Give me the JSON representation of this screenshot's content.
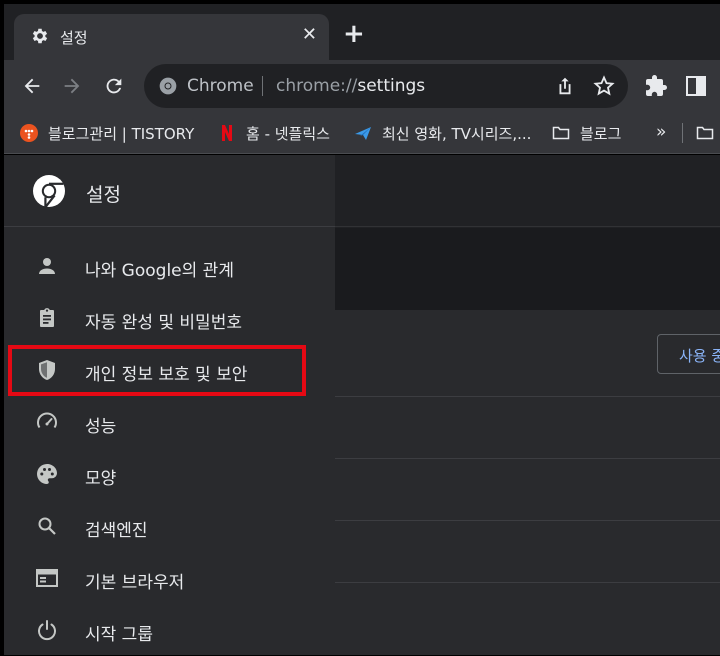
{
  "tab": {
    "title": "설정",
    "close": "✕"
  },
  "new_tab": "+",
  "omnibox": {
    "site_label": "Chrome",
    "url_scheme": "chrome://",
    "url_path": "settings"
  },
  "bookmarks": [
    {
      "label": "블로그관리 | TISTORY",
      "icon": "tistory-icon"
    },
    {
      "label": "홈 - 넷플릭스",
      "icon": "netflix-icon"
    },
    {
      "label": "최신 영화, TV시리즈,...",
      "icon": "plane-icon"
    },
    {
      "label": "블로그",
      "icon": "folder-icon"
    }
  ],
  "bookmarks_more": "»",
  "sidebar": {
    "title": "설정",
    "items": [
      {
        "label": "나와 Google의 관계",
        "icon": "person-icon"
      },
      {
        "label": "자동 완성 및 비밀번호",
        "icon": "clipboard-icon"
      },
      {
        "label": "개인 정보 보호 및 보안",
        "icon": "shield-icon"
      },
      {
        "label": "성능",
        "icon": "speedometer-icon"
      },
      {
        "label": "모양",
        "icon": "palette-icon"
      },
      {
        "label": "검색엔진",
        "icon": "search-icon"
      },
      {
        "label": "기본 브라우저",
        "icon": "browser-icon"
      },
      {
        "label": "시작 그룹",
        "icon": "power-icon"
      }
    ]
  },
  "main": {
    "card_button": "사용 중"
  },
  "colors": {
    "highlight": "#e50914",
    "accent": "#8ab4f8"
  }
}
